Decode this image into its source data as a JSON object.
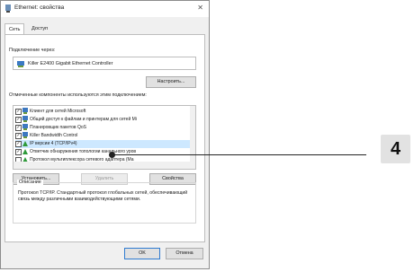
{
  "window": {
    "title": "Ethernet: свойства"
  },
  "tabs": [
    {
      "label": "Сеть"
    },
    {
      "label": "Доступ"
    }
  ],
  "connect_using": {
    "label": "Подключение через:",
    "adapter": "Killer E2400 Gigabit Ethernet Controller",
    "configure_button": "Настроить..."
  },
  "components": {
    "label": "Отмеченные компоненты используются этим подключением:",
    "items": [
      {
        "text": "Клиент для сетей Microsoft",
        "checked": true,
        "icon": "network-client-icon"
      },
      {
        "text": "Общий доступ к файлам и принтерам для сетей Mi",
        "checked": true,
        "icon": "file-sharing-icon"
      },
      {
        "text": "Планировщик пакетов QoS",
        "checked": true,
        "icon": "qos-icon"
      },
      {
        "text": "Killer Bandwidth Control",
        "checked": true,
        "icon": "bandwidth-icon"
      },
      {
        "text": "IP версии 4 (TCP/IPv4)",
        "checked": true,
        "selected": true,
        "icon": "protocol-icon"
      },
      {
        "text": "Ответчик обнаружения топологии канального уров",
        "checked": true,
        "icon": "protocol-icon"
      },
      {
        "text": "Протокол мультиплексора сетевого адаптера (Ma",
        "checked": false,
        "icon": "protocol-icon"
      }
    ]
  },
  "buttons": {
    "install": "Установить...",
    "remove": "Удалить",
    "properties": "Свойства"
  },
  "description": {
    "label": "Описание",
    "text": "Протокол TCP/IP. Стандартный протокол глобальных сетей, обеспечивающий связь между различными взаимодействующими сетями."
  },
  "footer": {
    "ok": "OK",
    "cancel": "Отмена"
  },
  "callout": {
    "number": "4"
  }
}
